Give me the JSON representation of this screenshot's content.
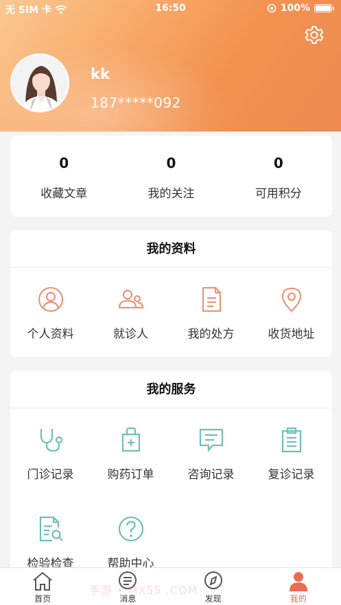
{
  "status_bar": {
    "carrier": "无 SIM 卡",
    "time": "16:50",
    "battery": "100%"
  },
  "header": {
    "username": "kk",
    "phone": "187*****092"
  },
  "stats": [
    {
      "value": "0",
      "label": "收藏文章"
    },
    {
      "value": "0",
      "label": "我的关注"
    },
    {
      "value": "0",
      "label": "可用积分"
    }
  ],
  "profile_section": {
    "title": "我的资料",
    "items": [
      {
        "label": "个人资料",
        "icon": "user-circle-icon"
      },
      {
        "label": "就诊人",
        "icon": "patients-icon"
      },
      {
        "label": "我的处方",
        "icon": "prescription-document-icon"
      },
      {
        "label": "收货地址",
        "icon": "location-pin-icon"
      }
    ]
  },
  "services_section": {
    "title": "我的服务",
    "items": [
      {
        "label": "门诊记录",
        "icon": "stethoscope-icon"
      },
      {
        "label": "购药订单",
        "icon": "medicine-bag-icon"
      },
      {
        "label": "咨询记录",
        "icon": "chat-bubble-icon"
      },
      {
        "label": "复诊记录",
        "icon": "clipboard-icon"
      },
      {
        "label": "检验检查",
        "icon": "report-search-icon"
      },
      {
        "label": "帮助中心",
        "icon": "help-circle-icon"
      }
    ]
  },
  "tabbar": [
    {
      "label": "首页",
      "icon": "home-icon"
    },
    {
      "label": "消息",
      "icon": "message-icon"
    },
    {
      "label": "发现",
      "icon": "compass-icon"
    },
    {
      "label": "我的",
      "icon": "person-icon",
      "active": true
    }
  ],
  "watermark": "手游 • MX55 .COM",
  "colors": {
    "accent": "#ee6a52",
    "profile_icon": "#e8957a",
    "service_icon": "#6fbfb8"
  }
}
